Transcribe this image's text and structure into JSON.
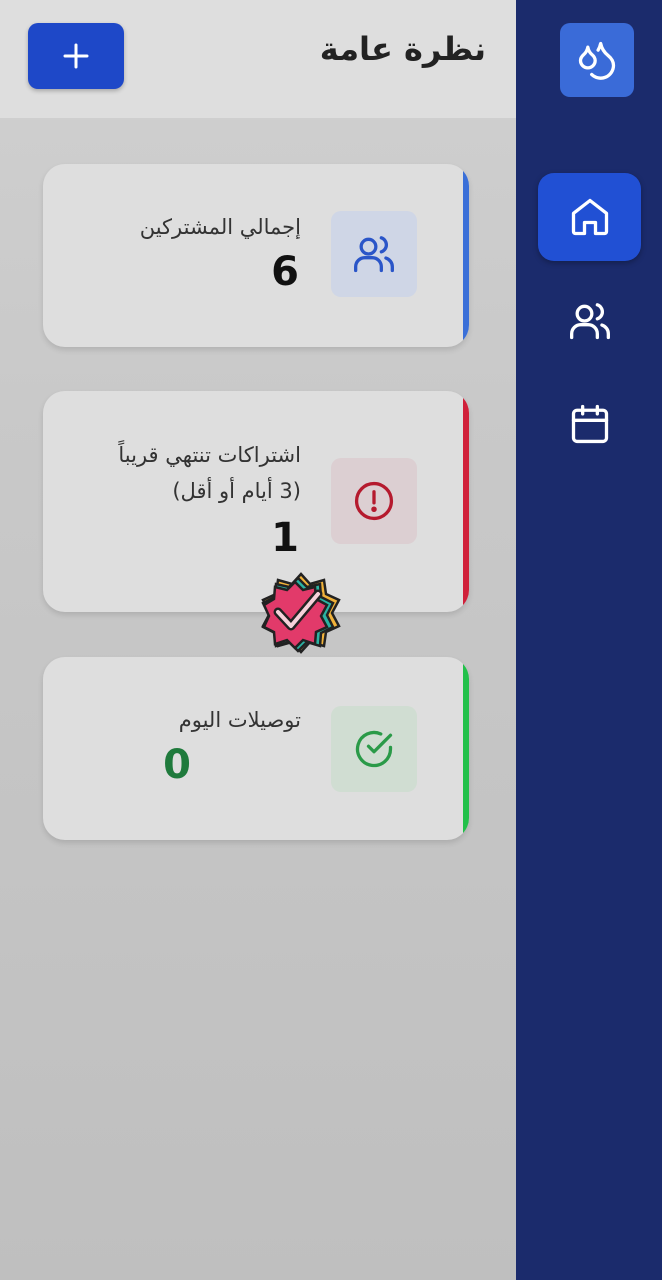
{
  "header": {
    "title": "نظرة عامة",
    "add_label": "+"
  },
  "sidebar": {
    "logo_icon": "water-drops-icon",
    "items": [
      {
        "icon": "home-icon",
        "active": true
      },
      {
        "icon": "users-icon",
        "active": false
      },
      {
        "icon": "calendar-icon",
        "active": false
      }
    ]
  },
  "cards": [
    {
      "label": "إجمالي المشتركين",
      "value": "6",
      "icon": "users-icon",
      "accent": "#3a6fd8",
      "value_color": "#111111"
    },
    {
      "label_line1": "اشتراكات تنتهي قريباً",
      "label_line2": "(3 أيام أو أقل)",
      "value": "1",
      "icon": "alert-circle-icon",
      "accent": "#d0203a",
      "value_color": "#111111"
    },
    {
      "label": "توصيلات اليوم",
      "value": "0",
      "icon": "check-circle-icon",
      "accent": "#22c04a",
      "value_color": "#1f7a3c"
    }
  ],
  "colors": {
    "sidebar_bg": "#1b2b6c",
    "primary": "#1e48c8",
    "danger": "#d0203a",
    "success": "#22c04a"
  }
}
